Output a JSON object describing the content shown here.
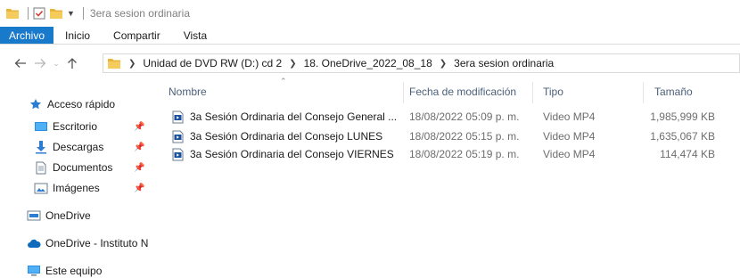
{
  "window": {
    "title": "3era sesion ordinaria"
  },
  "ribbon": {
    "tabs": [
      "Archivo",
      "Inicio",
      "Compartir",
      "Vista"
    ]
  },
  "address": {
    "crumbs": [
      "Unidad de DVD RW (D:) cd 2",
      "18. OneDrive_2022_08_18",
      "3era sesion ordinaria"
    ]
  },
  "nav": {
    "items": [
      {
        "label": "Acceso rápido",
        "icon": "star-icon"
      },
      {
        "label": "Escritorio",
        "icon": "desktop-icon",
        "pinned": true
      },
      {
        "label": "Descargas",
        "icon": "download-icon",
        "pinned": true
      },
      {
        "label": "Documentos",
        "icon": "document-icon",
        "pinned": true
      },
      {
        "label": "Imágenes",
        "icon": "images-icon",
        "pinned": true
      },
      {
        "label": "OneDrive",
        "icon": "onedrive-icon"
      },
      {
        "label": "OneDrive - Instituto N",
        "icon": "cloud-icon"
      },
      {
        "label": "Este equipo",
        "icon": "computer-icon"
      }
    ]
  },
  "columns": {
    "name": "Nombre",
    "modified": "Fecha de modificación",
    "type": "Tipo",
    "size": "Tamaño"
  },
  "files": [
    {
      "name": "3a Sesión Ordinaria del Consejo General ...",
      "modified": "18/08/2022 05:09 p. m.",
      "type": "Video MP4",
      "size": "1,985,999 KB"
    },
    {
      "name": "3a Sesión Ordinaria del Consejo LUNES",
      "modified": "18/08/2022 05:15 p. m.",
      "type": "Video MP4",
      "size": "1,635,067 KB"
    },
    {
      "name": "3a Sesión Ordinaria del Consejo VIERNES",
      "modified": "18/08/2022 05:19 p. m.",
      "type": "Video MP4",
      "size": "114,474 KB"
    }
  ],
  "colors": {
    "accent": "#1979ca",
    "folder": "#e8b53c",
    "header_text": "#4c607a"
  }
}
